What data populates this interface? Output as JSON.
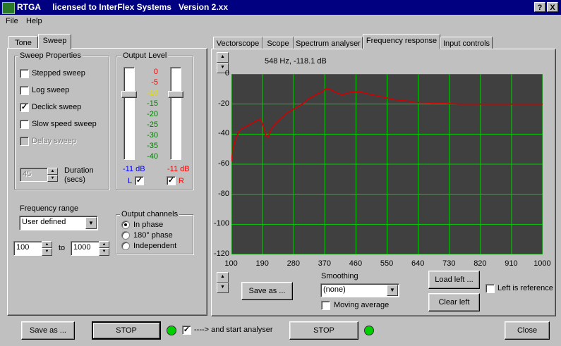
{
  "window": {
    "title": "RTGA     licensed to InterFlex Systems   Version 2.xx",
    "help_button": "?",
    "close_button": "X"
  },
  "menu": {
    "file": "File",
    "help": "Help"
  },
  "left_tabs": {
    "tone": "Tone",
    "sweep": "Sweep"
  },
  "sweep_properties": {
    "title": "Sweep Properties",
    "stepped_sweep": "Stepped sweep",
    "log_sweep": "Log sweep",
    "declick_sweep": "Declick sweep",
    "slow_speed_sweep": "Slow speed sweep",
    "delay_sweep": "Delay sweep",
    "duration_value": "45",
    "duration_label_1": "Duration",
    "duration_label_2": "(secs)"
  },
  "output_level": {
    "title": "Output Level",
    "scale": [
      "0",
      "-5",
      "-10",
      "-15",
      "-20",
      "-25",
      "-30",
      "-35",
      "-40"
    ],
    "left_db": "-11 dB",
    "right_db": "-11 dB",
    "left_label": "L",
    "right_label": "R",
    "left_fraction": 0.72,
    "right_fraction": 0.72
  },
  "frequency_range": {
    "label": "Frequency range",
    "mode": "User defined",
    "from": "100",
    "to_label": "to",
    "to": "1000"
  },
  "output_channels": {
    "title": "Output channels",
    "in_phase": "In phase",
    "phase_180": "180° phase",
    "independent": "Independent"
  },
  "right_tabs": {
    "vectorscope": "Vectorscope",
    "scope": "Scope",
    "spectrum": "Spectrum analyser",
    "frequency_response": "Frequency response",
    "input_controls": "Input controls"
  },
  "readout": "548 Hz,  -118.1 dB",
  "controls": {
    "save_as": "Save as ...",
    "smoothing_label": "Smoothing",
    "smoothing_value": "(none)",
    "moving_average": "Moving average",
    "load_left": "Load left ...",
    "clear_left": "Clear left",
    "left_is_reference": "Left is reference"
  },
  "bottom": {
    "save_as": "Save as ...",
    "stop1": "STOP",
    "start_analyser": "----> and start analyser",
    "stop2": "STOP",
    "close": "Close"
  },
  "colors": {
    "plot_bg": "#404040",
    "grid": "#00d000",
    "trace": "#d00000",
    "titlebar": "#000080"
  },
  "chart_data": {
    "type": "line",
    "title": "",
    "xlabel": "",
    "ylabel": "",
    "x_ticks": [
      "100",
      "190",
      "280",
      "370",
      "460",
      "550",
      "640",
      "730",
      "820",
      "910",
      "1000"
    ],
    "y_ticks": [
      "0",
      "-20",
      "-40",
      "-60",
      "-80",
      "-100",
      "-120"
    ],
    "xlim": [
      100,
      1000
    ],
    "ylim": [
      -120,
      0
    ],
    "grid": true,
    "series": [
      {
        "x": [
          100,
          104,
          110,
          118,
          126,
          134,
          142,
          150,
          158,
          166,
          174,
          182,
          188,
          194,
          200,
          206,
          212,
          220,
          232,
          246,
          260,
          275,
          290,
          305,
          320,
          335,
          350,
          362,
          372,
          382,
          392,
          400,
          410,
          420,
          432,
          446,
          460,
          475,
          490,
          510,
          530,
          550,
          570,
          590,
          610,
          630,
          650,
          680,
          720,
          760,
          800,
          840,
          880,
          920,
          960,
          1000
        ],
        "y": [
          -58,
          -50,
          -45,
          -40,
          -37,
          -36,
          -35,
          -34,
          -33,
          -32,
          -31,
          -30,
          -32,
          -36,
          -41,
          -42,
          -38,
          -35,
          -32,
          -29,
          -26,
          -24,
          -22,
          -20,
          -17,
          -15,
          -13,
          -12,
          -10,
          -10,
          -11,
          -12,
          -13,
          -14,
          -13,
          -12,
          -12,
          -12,
          -13,
          -14,
          -15,
          -16,
          -17,
          -17.5,
          -18,
          -19,
          -19,
          -19.5,
          -19.5,
          -20,
          -20,
          -20,
          -20,
          -20,
          -20,
          -20
        ]
      }
    ]
  }
}
